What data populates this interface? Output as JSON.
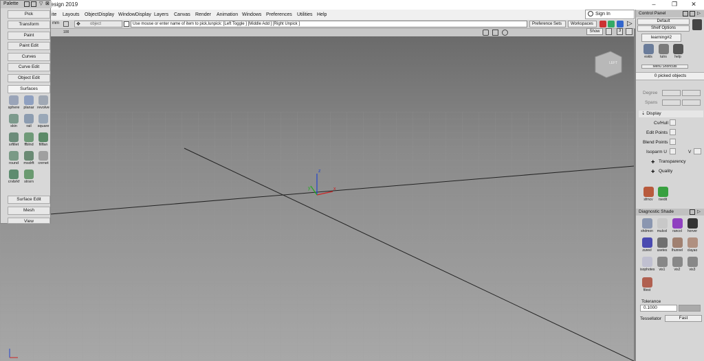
{
  "window": {
    "title": "esign 2019",
    "min": "–",
    "restore": "❐",
    "close": "✕"
  },
  "menubar": {
    "items": [
      "ite",
      "Layouts",
      "ObjectDisplay",
      "WindowDisplay",
      "Layers",
      "Canvas",
      "Render",
      "Animation",
      "Windows",
      "Preferences",
      "Utilities",
      "Help"
    ],
    "signin": "Sign In"
  },
  "toolrow": {
    "object_field": "object",
    "pick_message": "Use mouse or enter name of item to pick,lunpick: [Left Toggle ] [Middle Add ] [Right Unpick ]",
    "preference_sets": "Preference Sets",
    "workspaces": "Workspaces",
    "mm": "mm",
    "zoom": "100"
  },
  "viewport": {
    "show": "Show",
    "cube_label": "LEFT",
    "axis_x": "x",
    "axis_y": "y",
    "axis_z": "z"
  },
  "palette": {
    "title": "Palette",
    "buttons_top": [
      "Pick",
      "Transform",
      "Paint",
      "Paint Edit",
      "Curves",
      "Curve Edit",
      "Object Edit"
    ],
    "surfaces_header": "Surfaces",
    "tools": [
      "sphere",
      "planar",
      "revolve",
      "skin",
      "rail",
      "square",
      "srfillet",
      "ffblnd",
      "fillfan",
      "round",
      "msdrft",
      "cnrnet",
      "crvbrkf",
      "strsrn"
    ],
    "buttons_bottom": [
      "Surface Edit",
      "Mesh",
      "View"
    ]
  },
  "control_panel": {
    "title": "Control Panel",
    "default": "Default",
    "shelf_options": "Shelf Options",
    "shelf_tab": "learning#2",
    "shelf_items": [
      "eskls",
      "tutrs",
      "help"
    ],
    "menu_shortcuts": "Menu Shortcuts",
    "picked": "0 picked objects",
    "degree": "Degree",
    "spans": "Spans",
    "display_header": "Display",
    "cv_hull": "Cv/Hull",
    "edit_points": "Edit Points",
    "blend_points": "Blend Points",
    "isoparm_u": "Isoparm U",
    "v": "V",
    "transparency": "Transparency",
    "quality": "Quality",
    "bottom_tools": [
      "sfrncv",
      "rsedit"
    ],
    "diag_header": "Diagnostic Shade",
    "diag_items": [
      "shdmon",
      "mulcol",
      "rancol",
      "horver",
      "zurevl",
      "usetes",
      "lhunnel",
      "clayao",
      "isophotes",
      "vis1",
      "vis2",
      "vis3",
      "filest"
    ],
    "tolerance_label": "Tolerance",
    "tolerance_value": "0.1000",
    "tessellator_label": "Tessellator",
    "tessellator_value": "Fast"
  }
}
